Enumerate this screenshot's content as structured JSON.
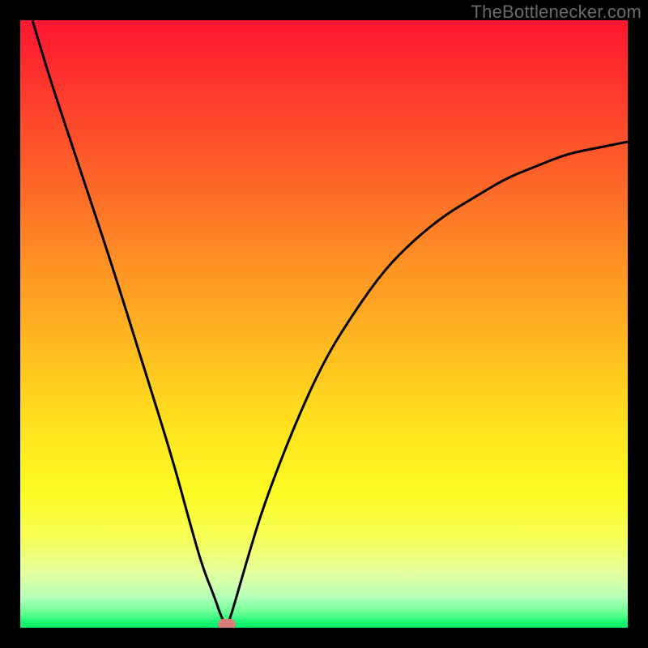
{
  "watermark": "TheBottlenecker.com",
  "colors": {
    "curve": "#000000",
    "marker": "#d87f7a",
    "frame": "#000000"
  },
  "chart_data": {
    "type": "line",
    "title": "",
    "xlabel": "",
    "ylabel": "",
    "xlim": [
      0,
      100
    ],
    "ylim": [
      0,
      100
    ],
    "series": [
      {
        "name": "bottleneck-curve",
        "x": [
          2,
          5,
          10,
          15,
          20,
          25,
          28,
          30,
          32,
          33,
          34,
          35,
          37,
          40,
          45,
          50,
          55,
          60,
          65,
          70,
          75,
          80,
          85,
          90,
          95,
          100
        ],
        "y": [
          100,
          90,
          75,
          60,
          44,
          28,
          17,
          10,
          5,
          2,
          0,
          3,
          10,
          20,
          33,
          44,
          52,
          59,
          64,
          68,
          71,
          74,
          76,
          78,
          79,
          80
        ]
      }
    ],
    "annotations": [
      {
        "name": "optimal-point",
        "x": 34,
        "y": 0
      }
    ]
  }
}
